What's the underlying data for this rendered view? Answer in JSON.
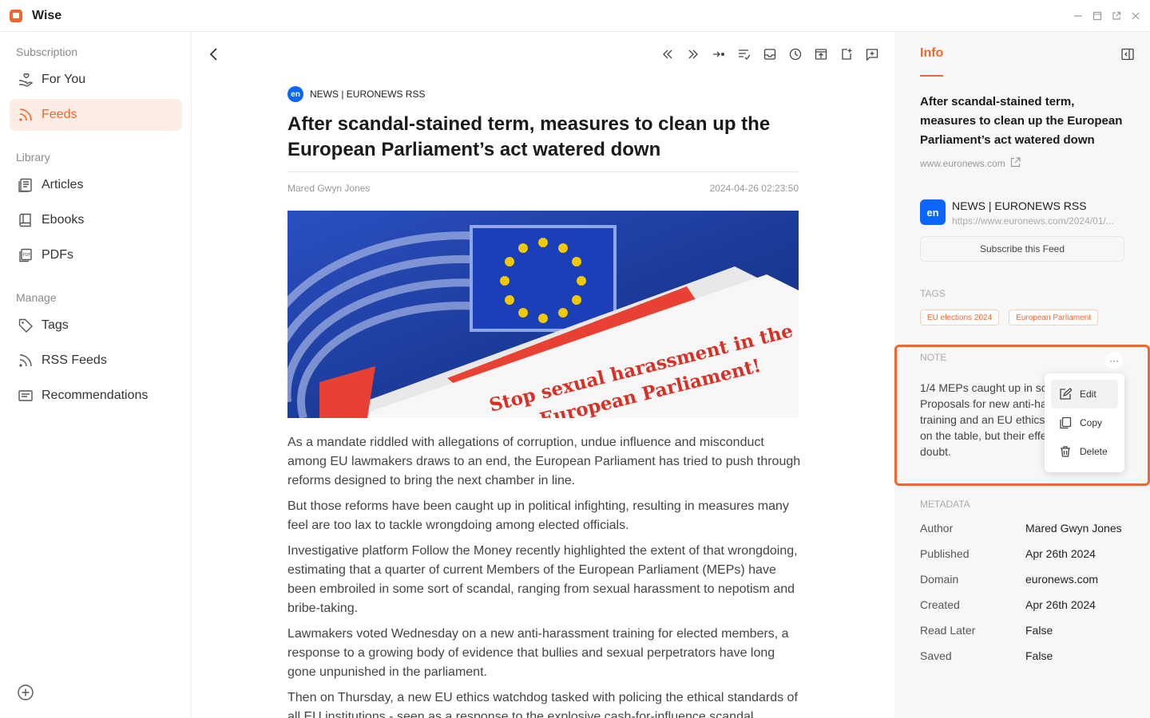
{
  "app": {
    "title": "Wise"
  },
  "sidebar": {
    "sections": {
      "subscription": "Subscription",
      "library": "Library",
      "manage": "Manage"
    },
    "items": [
      {
        "label": "For You",
        "icon": "hand-heart-icon"
      },
      {
        "label": "Feeds",
        "icon": "rss-icon",
        "active": true
      },
      {
        "label": "Articles",
        "icon": "article-icon"
      },
      {
        "label": "Ebooks",
        "icon": "book-icon"
      },
      {
        "label": "PDFs",
        "icon": "pdf-icon"
      },
      {
        "label": "Tags",
        "icon": "tag-icon"
      },
      {
        "label": "RSS Feeds",
        "icon": "rss-icon"
      },
      {
        "label": "Recommendations",
        "icon": "recommendations-icon"
      }
    ]
  },
  "article": {
    "source_badge": "en",
    "source": "NEWS | EURONEWS RSS",
    "title": "After scandal-stained term, measures to clean up the European Parliament’s act watered down",
    "author": "Mared Gwyn Jones",
    "date": "2024-04-26 02:23:50",
    "image_text_1": "Stop sexual harassment in the",
    "image_text_2": "European Parliament!",
    "paragraphs": [
      "As a mandate riddled with allegations of corruption, undue influence and misconduct among EU lawmakers draws to an end, the European Parliament has tried to push through reforms designed to bring the next chamber in line.",
      "But those reforms have been caught up in political infighting, resulting in measures many feel are too lax to tackle wrongdoing among elected officials.",
      "Investigative platform Follow the Money recently highlighted the extent of that wrongdoing, estimating that a quarter of current Members of the European Parliament (MEPs) have been embroiled in some sort of scandal, ranging from sexual harassment to nepotism and bribe-taking.",
      "Lawmakers voted Wednesday on a new anti-harassment training for elected members, a response to a growing body of evidence that bullies and sexual perpetrators have long gone unpunished in the parliament.",
      "Then on Thursday, a new EU ethics watchdog tasked with policing the ethical standards of all EU institutions - seen as a response to the explosive cash-for-influence scandal"
    ]
  },
  "info": {
    "tab": "Info",
    "title": "After scandal-stained term, measures to clean up the European Parliament’s act watered down",
    "domain": "www.euronews.com",
    "feed": {
      "badge": "en",
      "name": "NEWS | EURONEWS RSS",
      "url": "https://www.euronews.com/2024/01/..."
    },
    "subscribe_label": "Subscribe this Feed",
    "tags_label": "TAGS",
    "tags": [
      "EU elections 2024",
      "European Parliament"
    ],
    "note_label": "NOTE",
    "note_more": "···",
    "note_text": "1/4 MEPs caught up in sc Proposals for new anti-ha training and an EU ethics on the table, but their effe doubt.",
    "menu": [
      "Edit",
      "Copy",
      "Delete"
    ],
    "metadata_label": "METADATA",
    "metadata": [
      {
        "key": "Author",
        "value": "Mared Gwyn Jones"
      },
      {
        "key": "Published",
        "value": "Apr 26th 2024"
      },
      {
        "key": "Domain",
        "value": "euronews.com"
      },
      {
        "key": "Created",
        "value": "Apr 26th 2024"
      },
      {
        "key": "Read Later",
        "value": "False"
      },
      {
        "key": "Saved",
        "value": "False"
      }
    ]
  },
  "colors": {
    "accent": "#f0662b",
    "accent_bg": "#fdece4",
    "source_blue": "#0a66ff"
  }
}
